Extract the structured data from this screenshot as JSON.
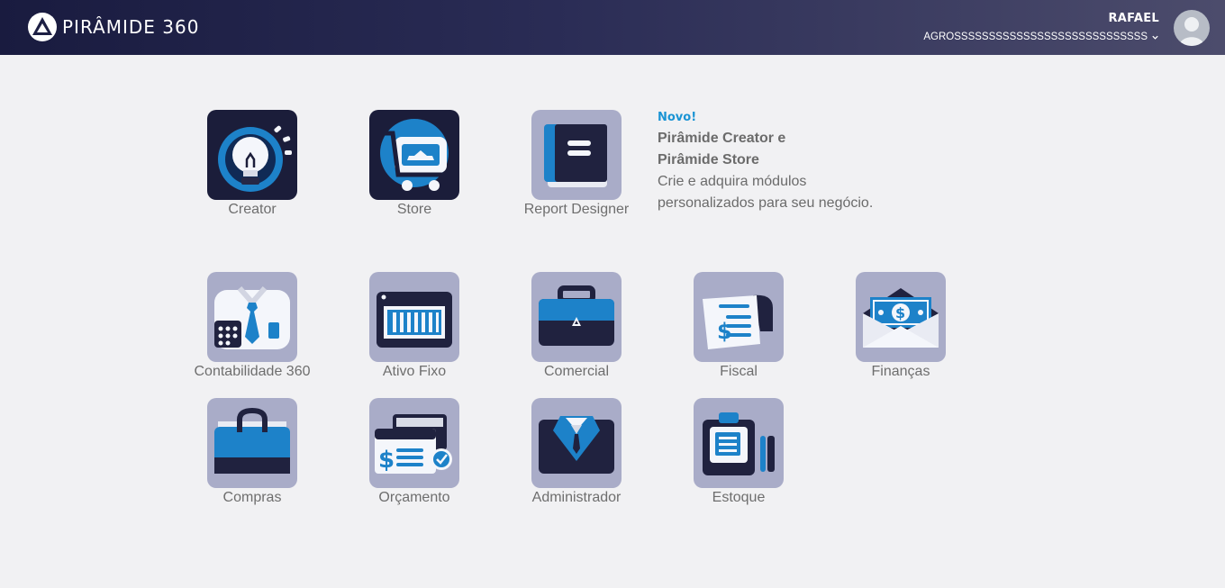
{
  "header": {
    "brand": "PIRÂMIDE 360",
    "logo_icon": "pyramid-logo-icon",
    "user_name": "RAFAEL",
    "company": "AGROSSSSSSSSSSSSSSSSSSSSSSSSSSSS",
    "dropdown_icon": "chevron-down-icon",
    "avatar_icon": "user-avatar-icon"
  },
  "colors": {
    "header_start": "#191b3f",
    "header_end": "#4c4c6c",
    "background": "#f1f1f3",
    "accent": "#1b94d4",
    "tile_light": "#a9acc8",
    "tile_dark": "#1d1e3a"
  },
  "featured_modules": [
    {
      "label": "Creator",
      "icon": "lightbulb-icon"
    },
    {
      "label": "Store",
      "icon": "shopping-cart-icon"
    },
    {
      "label": "Report Designer",
      "icon": "book-icon"
    }
  ],
  "promo": {
    "badge": "Novo!",
    "title_line1": "Pirâmide Creator e",
    "title_line2": "Pirâmide Store",
    "desc_line1": "Crie e adquira módulos",
    "desc_line2": "personalizados para seu negócio."
  },
  "modules": [
    {
      "label": "Contabilidade 360",
      "icon": "accountant-icon"
    },
    {
      "label": "Ativo Fixo",
      "icon": "fixed-asset-icon"
    },
    {
      "label": "Comercial",
      "icon": "briefcase-icon"
    },
    {
      "label": "Fiscal",
      "icon": "fiscal-document-icon"
    },
    {
      "label": "Finanças",
      "icon": "money-envelope-icon"
    },
    {
      "label": "Compras",
      "icon": "shopping-bag-icon"
    },
    {
      "label": "Orçamento",
      "icon": "budget-icon"
    },
    {
      "label": "Administrador",
      "icon": "admin-suit-icon"
    },
    {
      "label": "Estoque",
      "icon": "clipboard-inventory-icon"
    }
  ]
}
